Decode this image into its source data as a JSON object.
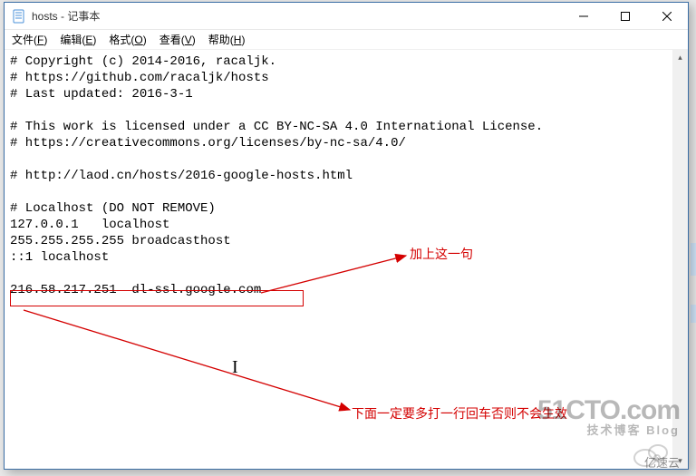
{
  "window": {
    "title": "hosts - 记事本"
  },
  "menu": {
    "file": {
      "label": "文件",
      "key": "F"
    },
    "edit": {
      "label": "编辑",
      "key": "E"
    },
    "format": {
      "label": "格式",
      "key": "O"
    },
    "view": {
      "label": "查看",
      "key": "V"
    },
    "help": {
      "label": "帮助",
      "key": "H"
    }
  },
  "editor": {
    "content": "# Copyright (c) 2014-2016, racaljk.\n# https://github.com/racaljk/hosts\n# Last updated: 2016-3-1\n\n# This work is licensed under a CC BY-NC-SA 4.0 International License.\n# https://creativecommons.org/licenses/by-nc-sa/4.0/\n\n# http://laod.cn/hosts/2016-google-hosts.html\n\n# Localhost (DO NOT REMOVE)\n127.0.0.1   localhost\n255.255.255.255 broadcasthost\n::1 localhost\n\n216.58.217.251  dl-ssl.google.com"
  },
  "annotations": {
    "add_line": "加上这一句",
    "need_enter": "下面一定要多打一行回车否则不会生效"
  },
  "watermark": {
    "main": "51CTO.com",
    "sub": "技术博客  Blog",
    "cloud": "亿速云"
  }
}
